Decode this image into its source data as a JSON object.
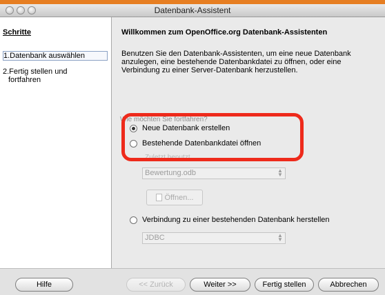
{
  "window": {
    "title": "Datenbank-Assistent"
  },
  "sidebar": {
    "heading": "Schritte",
    "steps": [
      {
        "label": "1.Datenbank auswählen"
      },
      {
        "label": "2.Fertig stellen und"
      },
      {
        "label": "fortfahren"
      }
    ]
  },
  "main": {
    "welcome": "Willkommen zum OpenOffice.org Datenbank-Assistenten",
    "intro": [
      "Benutzen Sie den Datenbank-Assistenten, um eine neue Datenbank",
      "anzulegen, eine bestehende Datenbankdatei zu öffnen, oder eine",
      "Verbindung zu einer Server-Datenbank herzustellen."
    ],
    "prompt": "Wie möchten Sie fortfahren?",
    "options": {
      "new_db": "Neue Datenbank erstellen",
      "open_existing": "Bestehende Datenbankdatei öffnen",
      "connect": "Verbindung zu einer bestehenden Datenbank herstellen"
    },
    "selected_option": "new_db",
    "recent_label": "Zuletzt benutzt",
    "recent_value": "Bewertung.odb",
    "open_button": "Öffnen...",
    "connection_type": "JDBC"
  },
  "footer": {
    "help": "Hilfe",
    "back": "<< Zurück",
    "next": "Weiter >>",
    "finish": "Fertig stellen",
    "cancel": "Abbrechen"
  },
  "colors": {
    "highlight": "#ee2a1b",
    "accent_strip": "#e67e22"
  }
}
